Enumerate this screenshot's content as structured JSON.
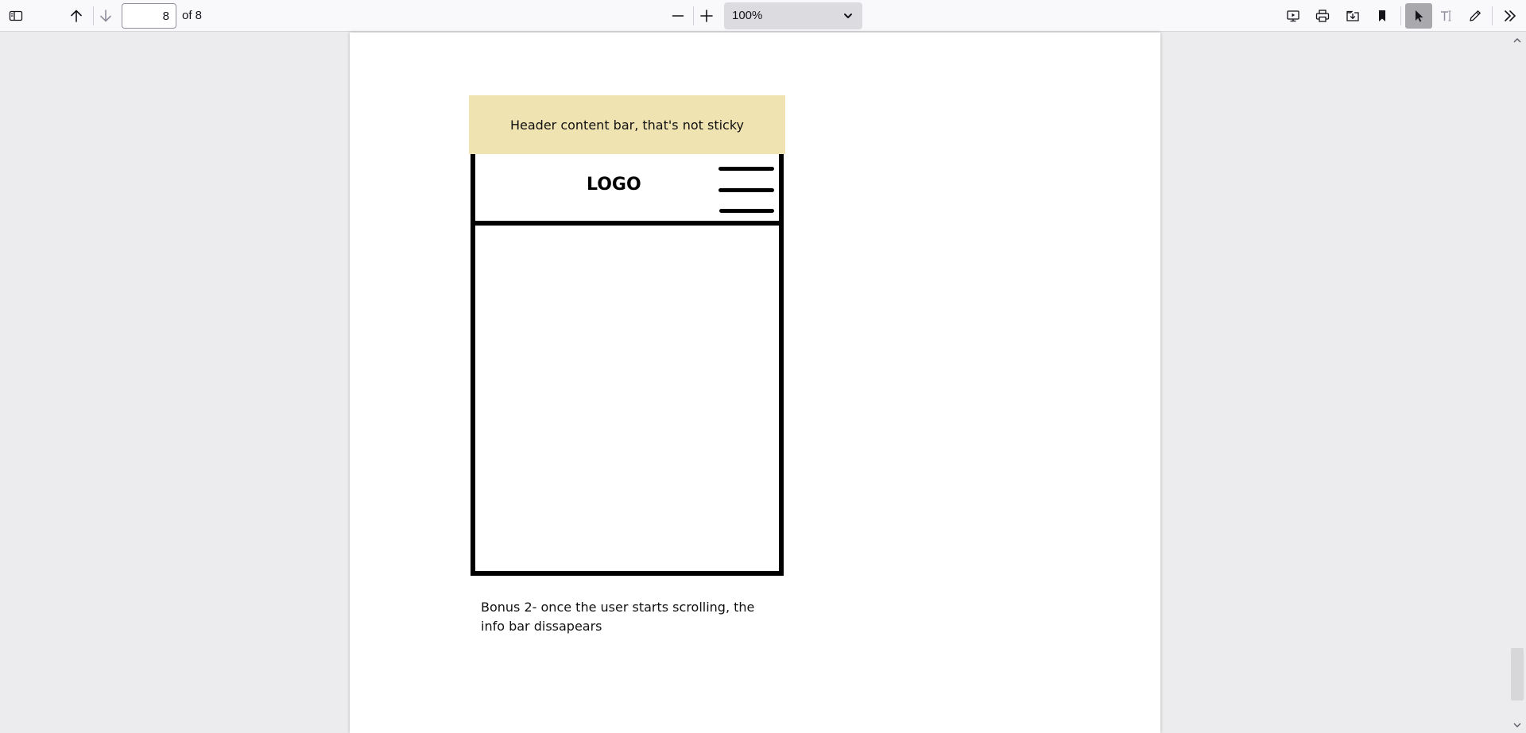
{
  "toolbar": {
    "sidebar_toggle_icon": "sidebar-icon",
    "prev_page_icon": "arrow-up-icon",
    "next_page_icon": "arrow-down-icon",
    "page_number": "8",
    "page_count": "of 8",
    "zoom_out_icon": "minus-icon",
    "zoom_in_icon": "plus-icon",
    "zoom_value": "100%",
    "presentation_icon": "presentation-icon",
    "print_icon": "print-icon",
    "save_icon": "save-icon",
    "bookmark_icon": "bookmark-icon",
    "select_tool_icon": "cursor-icon",
    "text_tool_icon": "text-icon",
    "draw_tool_icon": "pencil-icon",
    "more_tools_icon": "double-chevron-icon"
  },
  "document": {
    "info_bar_text": "Header content bar, that's not sticky",
    "logo_text": "LOGO",
    "menu_icon": "hamburger-icon",
    "caption_line1": "Bonus 2- once the user starts scrolling, the",
    "caption_line2": "info bar dissapears",
    "info_bar_color": "#efe3b1"
  }
}
